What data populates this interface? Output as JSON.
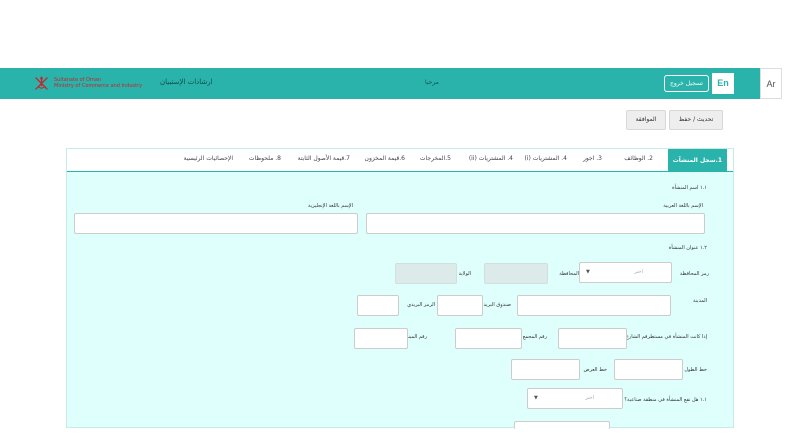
{
  "header": {
    "ministry_lines": [
      "Sultanate of Oman",
      "Ministry of Commerce and Industry"
    ],
    "app_title": "ارشادات الإستبيان",
    "welcome": "مرحبا",
    "logout_label": "تسجيل خروج",
    "lang_en": "En",
    "lang_ar": "Ar"
  },
  "actions": {
    "update_save": "تحديث / حفظ",
    "approve": "الموافقة"
  },
  "tabs": [
    "1.سجل المنشآت",
    "2. الوظائف",
    "3. اجور",
    "4. المشتريات (i)",
    "4. المشتريات (ii)",
    "5.المخرجات",
    "6.قيمة المخزون",
    "7.قيمة الأصول الثابتة",
    "8. ملحوظات",
    "الإحصائيات الرئيسية"
  ],
  "form": {
    "section_name": "١.١ اسم المنشأة",
    "arabic_name_label": "الإسم باللغة العربية",
    "english_name_label": "الإسم باللغة الإنجليزية",
    "section_address": "١.٢ عنوان المنشأة",
    "governorate_code_label": "رمز المحافظة",
    "governorate_code_placeholder": "اختر",
    "governorate_label": "المحافظة",
    "wilayat_label": "الولاية",
    "city_label": "المدينة",
    "po_box_label": "صندوق البريد",
    "postal_code_label": "الرمز البريدي",
    "street_label": "إذا كانت المنشأة في مستطرقم الشارع",
    "complex_label": "رقم المجمع",
    "building_label": "رقم المبنى",
    "longitude_label": "خط الطول",
    "latitude_label": "خط العرض",
    "industrial_zone_label": "١.١ هل تقع المنشأة في منطقة صناعية؟",
    "industrial_zone_placeholder": "اختر"
  }
}
